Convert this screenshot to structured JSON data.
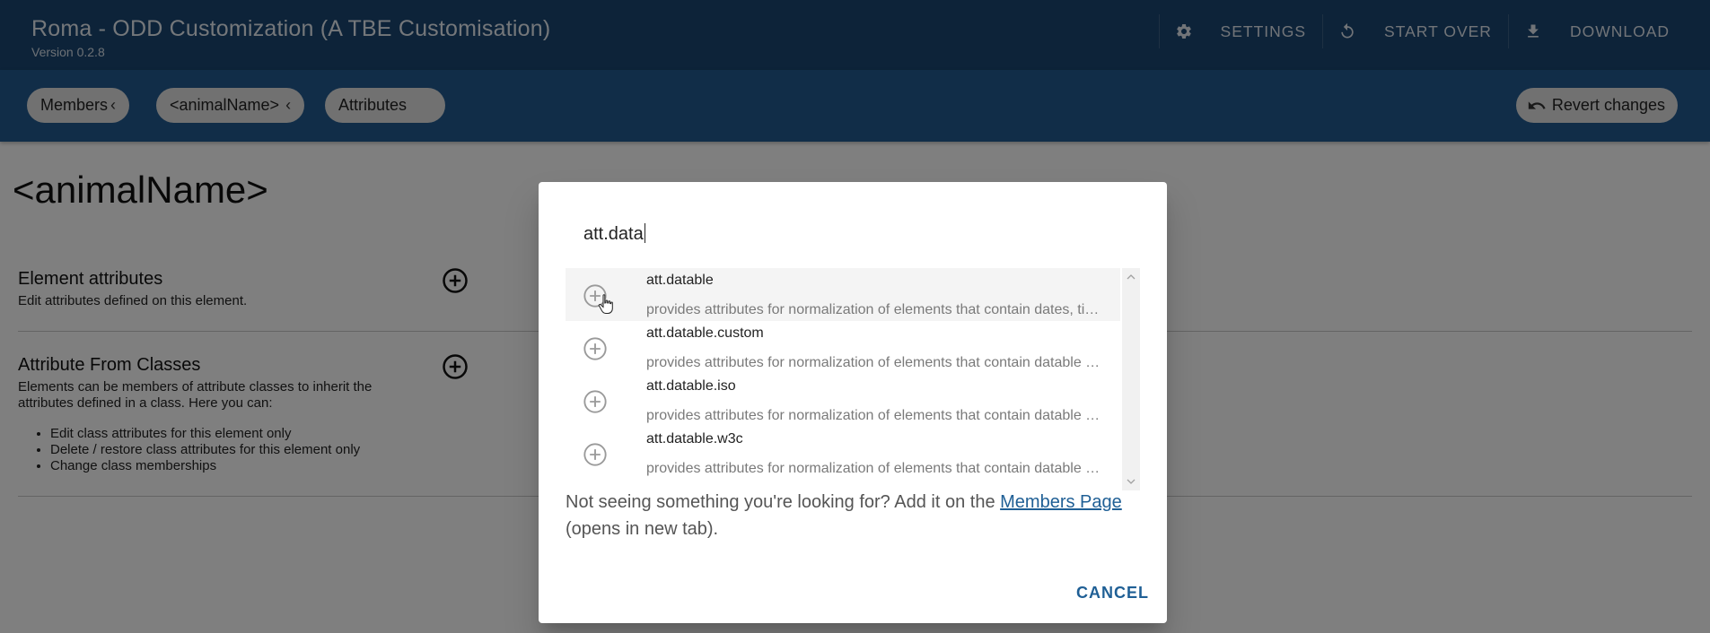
{
  "app": {
    "title": "Roma - ODD Customization (A TBE Customisation)",
    "version": "Version 0.2.8",
    "actions": [
      {
        "label": "SETTINGS",
        "icon": "gear-icon"
      },
      {
        "label": "START OVER",
        "icon": "restart-icon"
      },
      {
        "label": "DOWNLOAD",
        "icon": "download-icon"
      }
    ]
  },
  "breadcrumbs": [
    {
      "label": "Members",
      "chevron": "‹"
    },
    {
      "label": "<animalName>",
      "chevron": "‹"
    },
    {
      "label": "Attributes",
      "chevron": ""
    }
  ],
  "revert": {
    "label": "Revert changes",
    "icon": "undo-icon"
  },
  "page": {
    "title": "<animalName>",
    "sections": [
      {
        "title": "Element attributes",
        "description": "Edit attributes defined on this element."
      },
      {
        "title": "Attribute From Classes",
        "description": "Elements can be members of attribute classes to inherit the attributes defined in a class. Here you can:",
        "bullets": [
          "Edit class attributes for this element only",
          "Delete / restore class attributes for this element only",
          "Change class memberships"
        ]
      }
    ]
  },
  "dialog": {
    "search_value": "att.data",
    "results": [
      {
        "name": "att.datable",
        "description": "provides attributes for normalization of elements that contain dates, times, or datable events."
      },
      {
        "name": "att.datable.custom",
        "description": "provides attributes for normalization of elements that contain datable events."
      },
      {
        "name": "att.datable.iso",
        "description": "provides attributes for normalization of elements that contain datable events."
      },
      {
        "name": "att.datable.w3c",
        "description": "provides attributes for normalization of elements that contain datable events."
      }
    ],
    "note_prefix": "Not seeing something you're looking for? Add it on the ",
    "note_link": "Members Page",
    "note_suffix": " (opens in new tab).",
    "cancel_label": "CANCEL"
  },
  "colors": {
    "appbar": "#1a4672",
    "subbar": "#235b91",
    "link": "#1f5f95"
  }
}
